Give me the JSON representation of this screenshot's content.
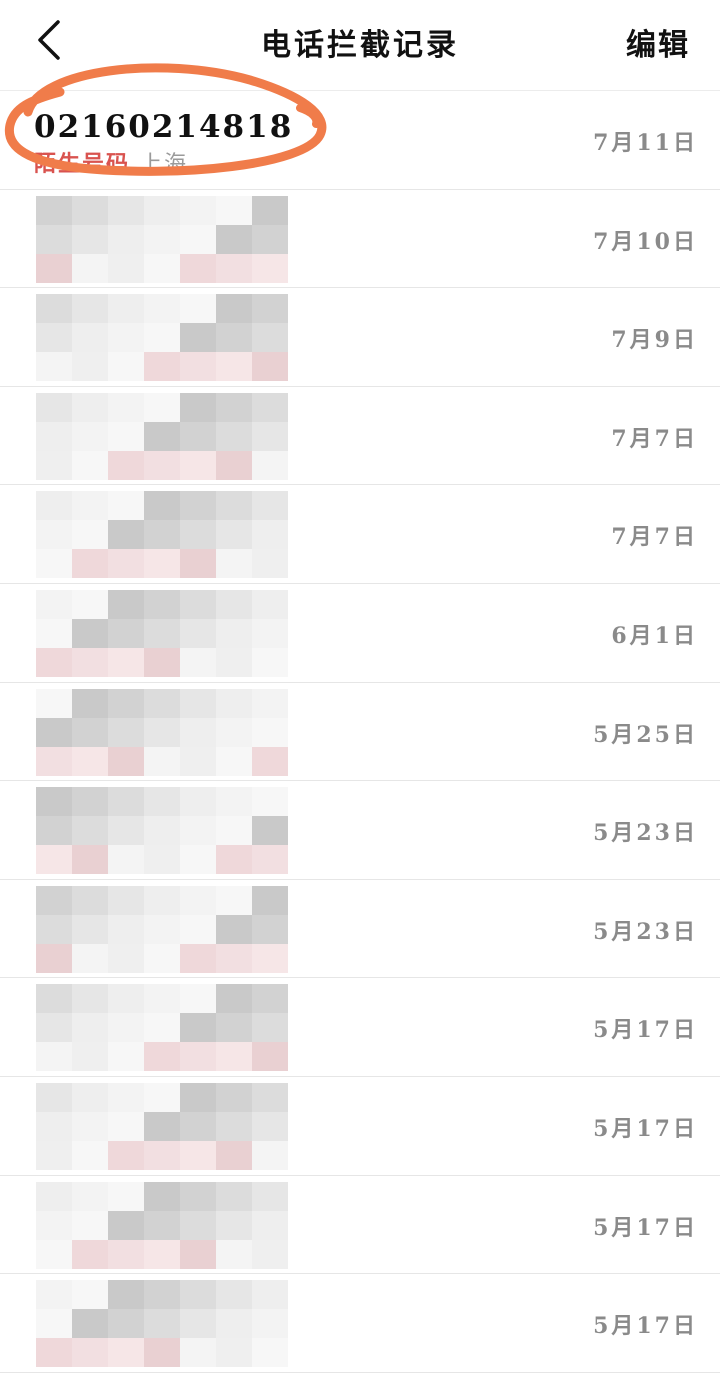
{
  "header": {
    "title": "电话拦截记录",
    "edit_label": "编辑"
  },
  "records": [
    {
      "number": "02160214818",
      "tag": "陌生号码",
      "location": "上海",
      "date": "7月11日",
      "redacted": false
    },
    {
      "number": "",
      "tag": "",
      "location": "",
      "date": "7月10日",
      "redacted": true
    },
    {
      "number": "",
      "tag": "",
      "location": "",
      "date": "7月9日",
      "redacted": true
    },
    {
      "number": "",
      "tag": "",
      "location": "",
      "date": "7月7日",
      "redacted": true
    },
    {
      "number": "",
      "tag": "",
      "location": "",
      "date": "7月7日",
      "redacted": true
    },
    {
      "number": "",
      "tag": "",
      "location": "",
      "date": "6月1日",
      "redacted": true
    },
    {
      "number": "",
      "tag": "",
      "location": "",
      "date": "5月25日",
      "redacted": true
    },
    {
      "number": "",
      "tag": "",
      "location": "",
      "date": "5月23日",
      "redacted": true
    },
    {
      "number": "",
      "tag": "",
      "location": "",
      "date": "5月23日",
      "redacted": true
    },
    {
      "number": "",
      "tag": "",
      "location": "",
      "date": "5月17日",
      "redacted": true
    },
    {
      "number": "",
      "tag": "",
      "location": "",
      "date": "5月17日",
      "redacted": true
    },
    {
      "number": "",
      "tag": "",
      "location": "",
      "date": "5月17日",
      "redacted": true
    },
    {
      "number": "",
      "tag": "",
      "location": "",
      "date": "5月17日",
      "redacted": true
    }
  ],
  "colors": {
    "tag": "#d9534f",
    "location": "#9a9a9a",
    "date": "#8a8a8a",
    "annotation_circle": "#f07c4a"
  },
  "icons": {
    "back": "chevron-left-icon"
  }
}
